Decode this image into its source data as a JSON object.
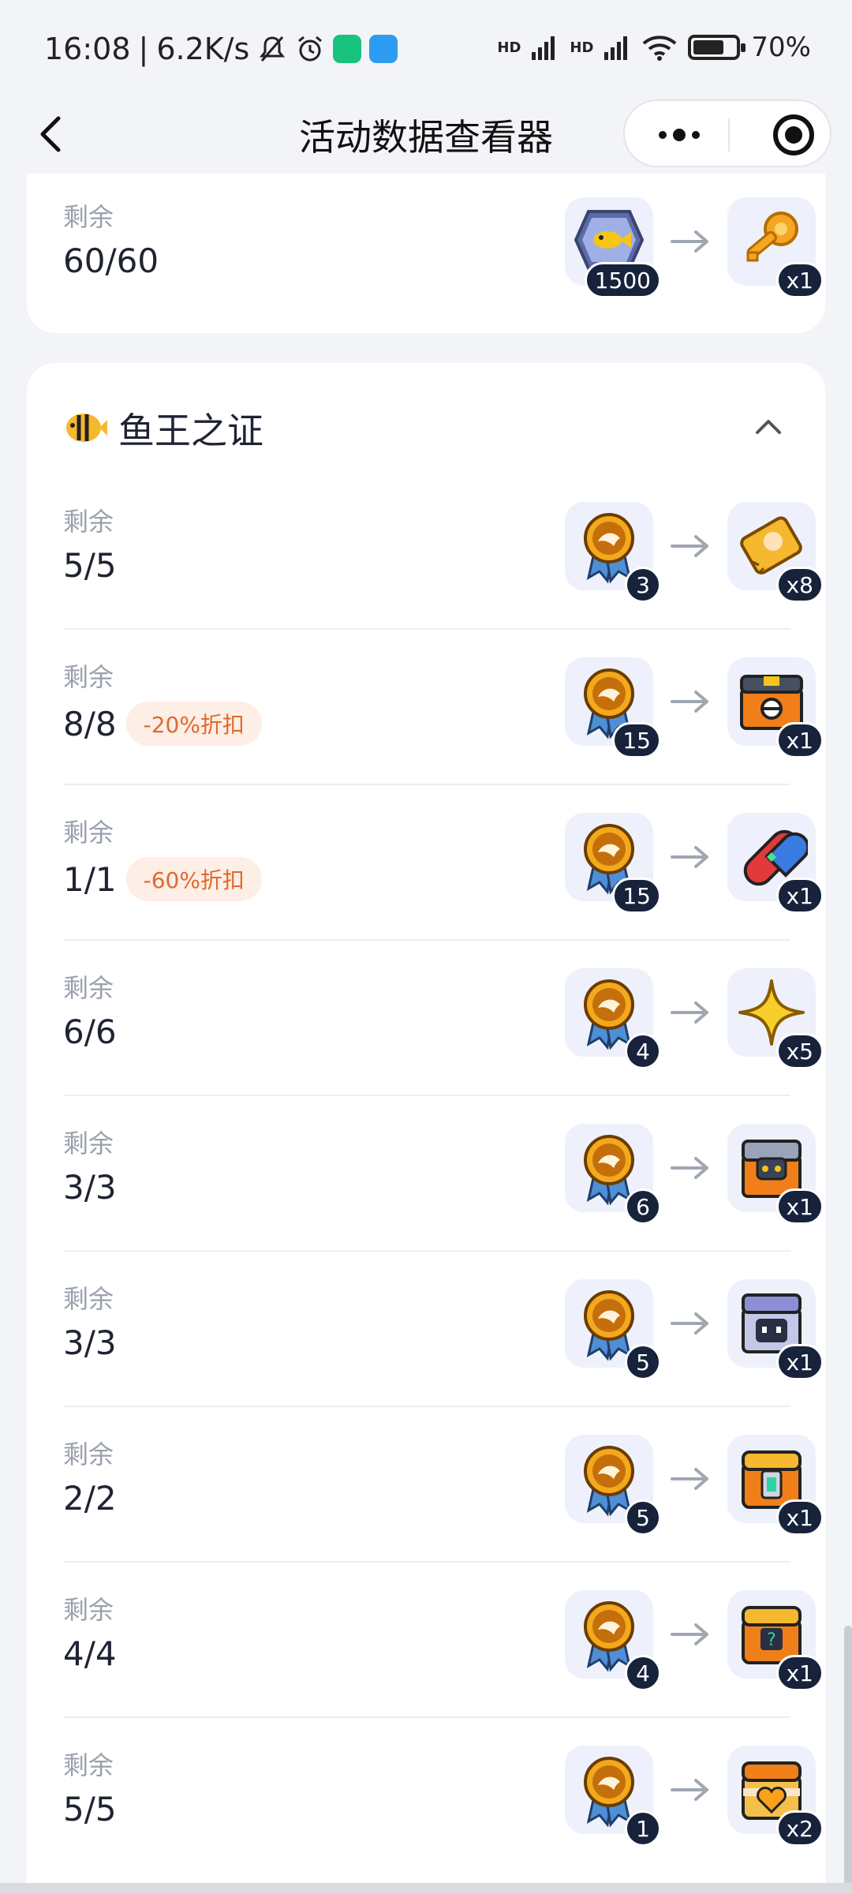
{
  "status_bar": {
    "time": "16:08",
    "speed": "6.2K/s",
    "signal1": "HD",
    "signal2": "HD",
    "battery_level": 0.7,
    "battery_text": "70%"
  },
  "nav": {
    "title": "活动数据查看器",
    "back_icon": "chevron-left-icon",
    "more_icon": "more-dots-icon",
    "close_icon": "target-close-icon"
  },
  "top_card": {
    "label": "剩余",
    "quantity": "60/60",
    "cost_badge": "1500",
    "reward_badge": "x1"
  },
  "section": {
    "title": "鱼王之证",
    "icon": "tropical-fish-icon",
    "collapse_icon": "chevron-up-icon"
  },
  "rows": [
    {
      "label": "剩余",
      "quantity": "5/5",
      "discount": "",
      "cost": "3",
      "reward": "x8",
      "reward_icon": "ticket-icon"
    },
    {
      "label": "剩余",
      "quantity": "8/8",
      "discount": "-20%折扣",
      "cost": "15",
      "reward": "x1",
      "reward_icon": "chest-orange-icon"
    },
    {
      "label": "剩余",
      "quantity": "1/1",
      "discount": "-60%折扣",
      "cost": "15",
      "reward": "x1",
      "reward_icon": "capsule-pill-icon"
    },
    {
      "label": "剩余",
      "quantity": "6/6",
      "discount": "",
      "cost": "4",
      "reward": "x5",
      "reward_icon": "star-icon"
    },
    {
      "label": "剩余",
      "quantity": "3/3",
      "discount": "",
      "cost": "6",
      "reward": "x1",
      "reward_icon": "chest-robot-icon"
    },
    {
      "label": "剩余",
      "quantity": "3/3",
      "discount": "",
      "cost": "5",
      "reward": "x1",
      "reward_icon": "chest-purple-icon"
    },
    {
      "label": "剩余",
      "quantity": "2/2",
      "discount": "",
      "cost": "5",
      "reward": "x1",
      "reward_icon": "chest-green-lock-icon"
    },
    {
      "label": "剩余",
      "quantity": "4/4",
      "discount": "",
      "cost": "4",
      "reward": "x1",
      "reward_icon": "chest-question-icon"
    },
    {
      "label": "剩余",
      "quantity": "5/5",
      "discount": "",
      "cost": "1",
      "reward": "x2",
      "reward_icon": "chest-heart-icon"
    }
  ]
}
